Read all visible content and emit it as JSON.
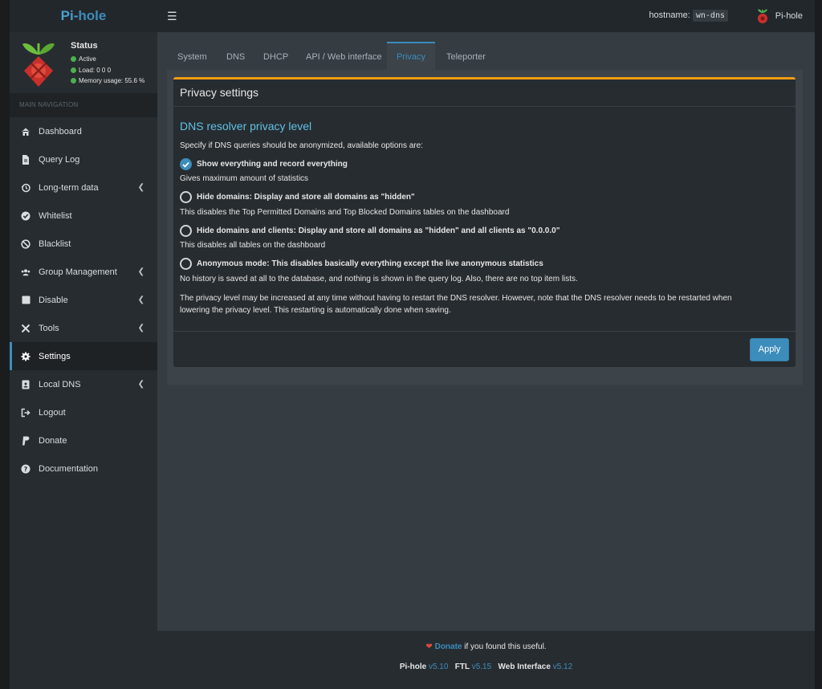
{
  "header": {
    "logo_pi": "Pi-",
    "logo_hole": "hole",
    "hostname_label": "hostname:",
    "hostname_value": "wn-dns",
    "user_name": "Pi-hole"
  },
  "status": {
    "title": "Status",
    "active": "Active",
    "load": "Load:  0  0  0",
    "memory": "Memory usage:  55.6 %"
  },
  "sidebar": {
    "heading": "MAIN NAVIGATION",
    "items": [
      {
        "label": "Dashboard",
        "icon": "home-icon"
      },
      {
        "label": "Query Log",
        "icon": "file-icon"
      },
      {
        "label": "Long-term data",
        "icon": "history-icon"
      },
      {
        "label": "Whitelist",
        "icon": "check-circle-icon"
      },
      {
        "label": "Blacklist",
        "icon": "ban-icon"
      },
      {
        "label": "Group Management",
        "icon": "users-icon"
      },
      {
        "label": "Disable",
        "icon": "stop-icon"
      },
      {
        "label": "Tools",
        "icon": "tools-icon"
      },
      {
        "label": "Settings",
        "icon": "gear-icon"
      },
      {
        "label": "Local DNS",
        "icon": "address-book-icon"
      },
      {
        "label": "Logout",
        "icon": "sign-out-icon"
      },
      {
        "label": "Donate",
        "icon": "paypal-icon"
      },
      {
        "label": "Documentation",
        "icon": "question-circle-icon"
      }
    ]
  },
  "tabs": [
    "System",
    "DNS",
    "DHCP",
    "API / Web interface",
    "Privacy",
    "Teleporter"
  ],
  "privacy": {
    "box_title": "Privacy settings",
    "section_title": "DNS resolver privacy level",
    "intro": "Specify if DNS queries should be anonymized, available options are:",
    "options": [
      {
        "label": "Show everything and record everything",
        "desc": "Gives maximum amount of statistics"
      },
      {
        "label": "Hide domains: Display and store all domains as \"hidden\"",
        "desc": "This disables the Top Permitted Domains and Top Blocked Domains tables on the dashboard"
      },
      {
        "label": "Hide domains and clients: Display and store all domains as \"hidden\" and all clients as \"0.0.0.0\"",
        "desc": "This disables all tables on the dashboard"
      },
      {
        "label": "Anonymous mode: This disables basically everything except the live anonymous statistics",
        "desc": "No history is saved at all to the database, and nothing is shown in the query log. Also, there are no top item lists."
      }
    ],
    "note_line1": "The privacy level may be increased at any time without having to restart the DNS resolver. However, note that the DNS resolver needs to be restarted when",
    "note_line2": "lowering the privacy level. This restarting is automatically done when saving.",
    "apply_label": "Apply"
  },
  "footer": {
    "donate_link": "Donate",
    "donate_text": " if you found this useful.",
    "pihole_label": "Pi-hole",
    "pihole_version": "v5.10",
    "ftl_label": "FTL",
    "ftl_version": "v5.15",
    "web_label": "Web Interface",
    "web_version": "v5.12"
  },
  "colors": {
    "accent": "#3c8dbc",
    "box_top_border": "#f39c12",
    "status_green": "#4caf50",
    "section_title": "#60c1e6"
  }
}
